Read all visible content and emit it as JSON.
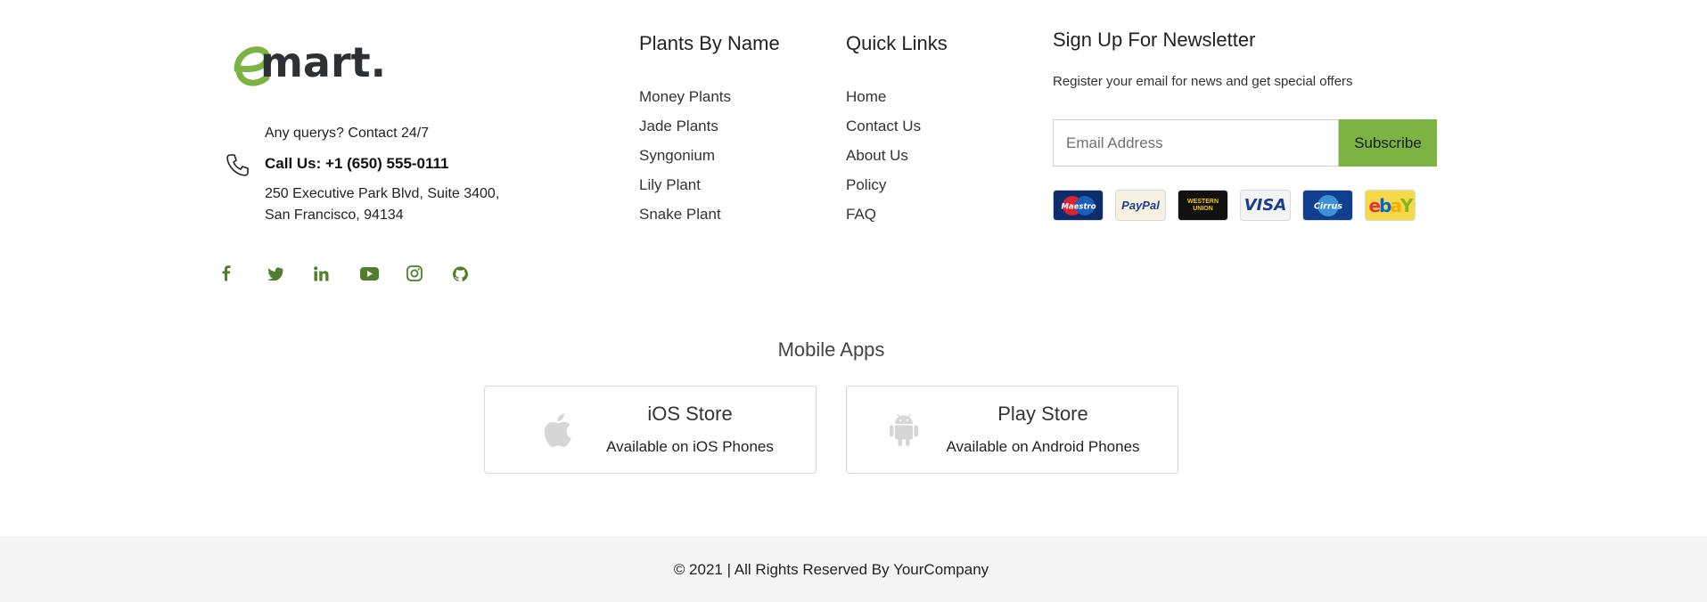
{
  "brand": {
    "logo_text": "mart.",
    "accent_color": "#7cb342",
    "text_color": "#2e3133"
  },
  "contact": {
    "query_text": "Any querys? Contact 24/7",
    "phone_text": "Call Us: +1 (650) 555-0111",
    "address_line1": "250 Executive Park Blvd, Suite 3400,",
    "address_line2": "San Francisco, 94134"
  },
  "socials": [
    "facebook-icon",
    "twitter-icon",
    "linkedin-icon",
    "youtube-icon",
    "instagram-icon",
    "github-icon"
  ],
  "plants": {
    "title": "Plants By Name",
    "items": [
      "Money Plants",
      "Jade Plants",
      "Syngonium",
      "Lily Plant",
      "Snake Plant"
    ]
  },
  "quick_links": {
    "title": "Quick Links",
    "items": [
      "Home",
      "Contact Us",
      "About Us",
      "Policy",
      "FAQ"
    ]
  },
  "newsletter": {
    "title": "Sign Up For Newsletter",
    "subtitle": "Register your email for news and get special offers",
    "email_placeholder": "Email Address",
    "button_label": "Subscribe"
  },
  "payments": {
    "maestro": "Maestro",
    "paypal": "PayPal",
    "western_union_1": "WESTERN",
    "western_union_2": "UNION",
    "visa": "VISA",
    "cirrus": "Cirrus",
    "ebay_e": "e",
    "ebay_b": "b",
    "ebay_a": "a",
    "ebay_y": "Y"
  },
  "mobile_apps": {
    "title": "Mobile Apps",
    "ios": {
      "name": "iOS Store",
      "desc": "Available on iOS Phones",
      "icon": "apple-icon"
    },
    "play": {
      "name": "Play Store",
      "desc": "Available on Android Phones",
      "icon": "android-icon"
    }
  },
  "footer": {
    "copyright": "© 2021 | All Rights Reserved By YourCompany"
  }
}
